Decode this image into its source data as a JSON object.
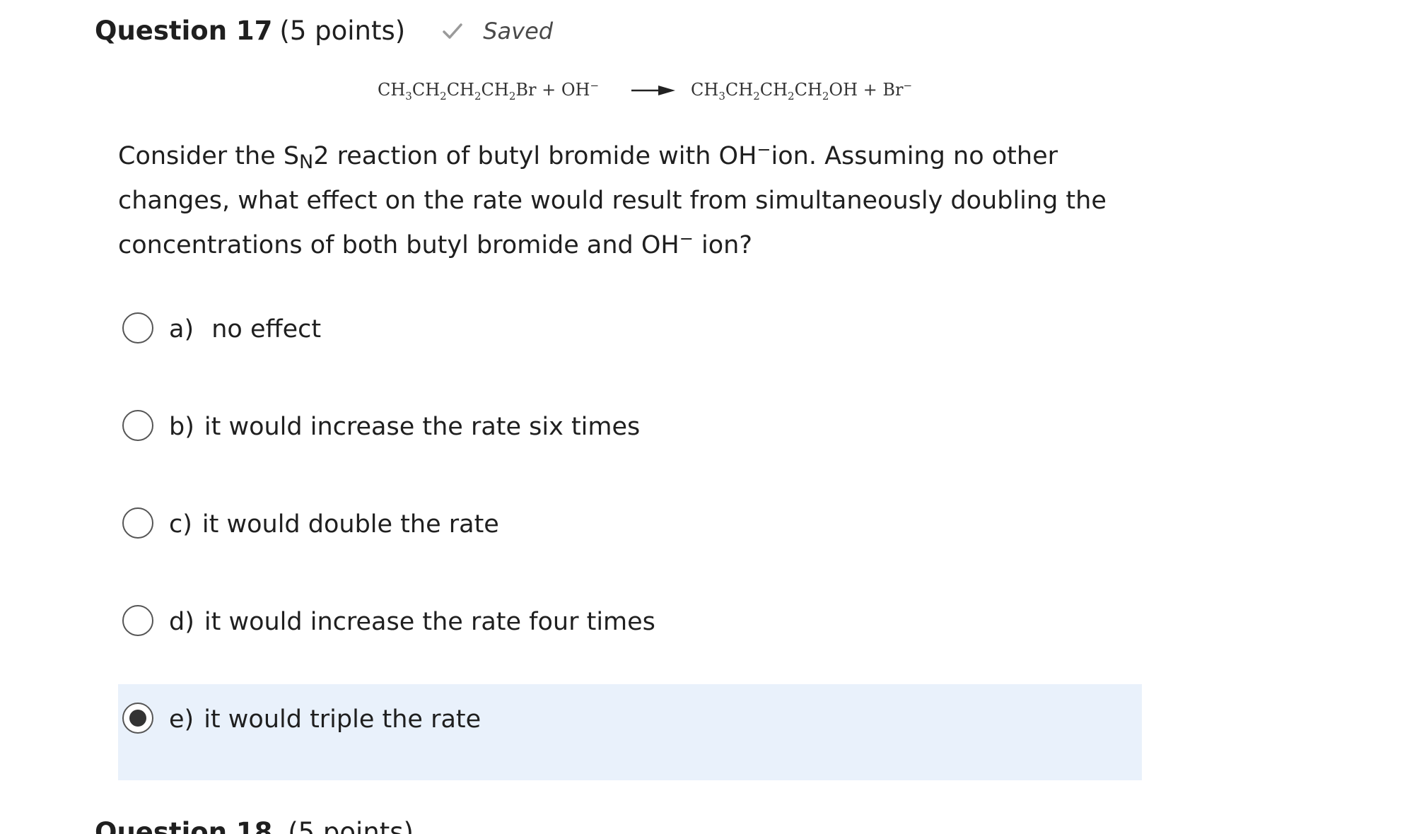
{
  "question": {
    "title": "Question 17",
    "points": "(5 points)",
    "saved_label": "Saved"
  },
  "reaction": {
    "reactant_parts": [
      "CH",
      "3",
      "CH",
      "2",
      "CH",
      "2",
      "CH",
      "2",
      "Br + OH",
      "−"
    ],
    "product_parts": [
      "CH",
      "3",
      "CH",
      "2",
      "CH",
      "2",
      "CH",
      "2",
      "OH + Br",
      "−"
    ]
  },
  "prompt": {
    "line_1_before": "Consider the S",
    "subscript": "N",
    "line_1_after": "2 reaction of butyl bromide with OH",
    "sup_1": "−",
    "line_1_end": "ion.  Assuming no other changes, what effect on the rate would result from simultaneously doubling the concentrations of both butyl bromide and OH",
    "sup_2": "−",
    "line_end": " ion?"
  },
  "options": [
    {
      "letter": "a)",
      "text": "no effect",
      "selected": false
    },
    {
      "letter": "b)",
      "text": "it would increase the rate six times",
      "selected": false
    },
    {
      "letter": "c)",
      "text": "it would double the rate",
      "selected": false
    },
    {
      "letter": "d)",
      "text": "it would increase the rate four times",
      "selected": false
    },
    {
      "letter": "e)",
      "text": "it would triple the rate",
      "selected": true
    }
  ],
  "next_question": {
    "title": "Question 18",
    "points": "(5 points)"
  },
  "colors": {
    "selected_background": "#e9f1fb",
    "check": "#9a9a9a"
  }
}
